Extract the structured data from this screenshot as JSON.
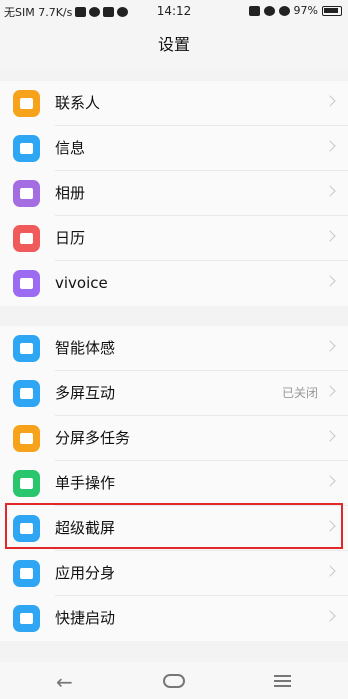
{
  "status_bar": {
    "left_text": "无SIM 7.7K/s",
    "time": "14:12",
    "battery": "97%"
  },
  "header": {
    "title": "设置"
  },
  "group1": [
    {
      "label": "联系人",
      "icon": "contacts-icon",
      "color": "#f7a21b"
    },
    {
      "label": "信息",
      "icon": "message-icon",
      "color": "#2ea6f4"
    },
    {
      "label": "相册",
      "icon": "album-icon",
      "color": "#a56de2"
    },
    {
      "label": "日历",
      "icon": "calendar-icon",
      "color": "#f05a5a"
    },
    {
      "label": "vivoice",
      "icon": "microphone-icon",
      "color": "#9b6cf2"
    }
  ],
  "group2": [
    {
      "label": "智能体感",
      "icon": "smart-motion-icon",
      "color": "#2ea6f4",
      "value": ""
    },
    {
      "label": "多屏互动",
      "icon": "multi-screen-icon",
      "color": "#2ea6f4",
      "value": "已关闭"
    },
    {
      "label": "分屏多任务",
      "icon": "split-screen-icon",
      "color": "#f7a21b",
      "value": ""
    },
    {
      "label": "单手操作",
      "icon": "one-hand-icon",
      "color": "#29c66e",
      "value": ""
    },
    {
      "label": "超级截屏",
      "icon": "screenshot-icon",
      "color": "#2ea6f4",
      "value": ""
    },
    {
      "label": "应用分身",
      "icon": "app-clone-icon",
      "color": "#2ea6f4",
      "value": ""
    },
    {
      "label": "快捷启动",
      "icon": "quick-launch-icon",
      "color": "#2ea6f4",
      "value": ""
    }
  ],
  "colors": {
    "highlight": "#e2282a",
    "chevron": "#c6c6c6"
  }
}
